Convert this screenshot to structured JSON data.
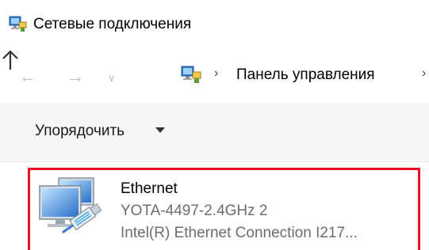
{
  "window": {
    "title": "Сетевые подключения",
    "icon": "network-connections-icon"
  },
  "navigation": {
    "back_icon": "back-arrow-icon",
    "forward_icon": "forward-arrow-icon",
    "recent_icon": "chevron-down-icon",
    "up_icon": "up-arrow-icon",
    "address": {
      "icon": "control-panel-icon",
      "separator": "›",
      "path": "Панель управления",
      "overflow": "›"
    }
  },
  "command_bar": {
    "organize_label": "Упорядочить"
  },
  "connections": [
    {
      "name": "Ethernet",
      "status": "YOTA-4497-2.4GHz 2",
      "device": "Intel(R) Ethernet Connection I217...",
      "icon": "ethernet-adapter-icon",
      "highlight_color": "#e81123"
    }
  ]
}
